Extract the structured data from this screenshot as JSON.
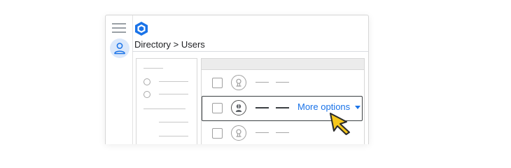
{
  "breadcrumb": {
    "section": "Directory",
    "separator": ">",
    "page": "Users"
  },
  "row_menu": {
    "more_options_label": "More options"
  },
  "icons": {
    "menu": "hamburger-menu-icon",
    "logo": "hexagon-logo-icon",
    "account": "person-icon",
    "dropdown": "caret-down-icon",
    "pointer": "mouse-cursor-icon"
  },
  "colors": {
    "accent": "#1a73e8",
    "avatar_background": "#dbe8fb",
    "cursor": "#f6c71b"
  },
  "table": {
    "rows": [
      {
        "selected": false
      },
      {
        "selected": true
      },
      {
        "selected": false
      }
    ]
  }
}
